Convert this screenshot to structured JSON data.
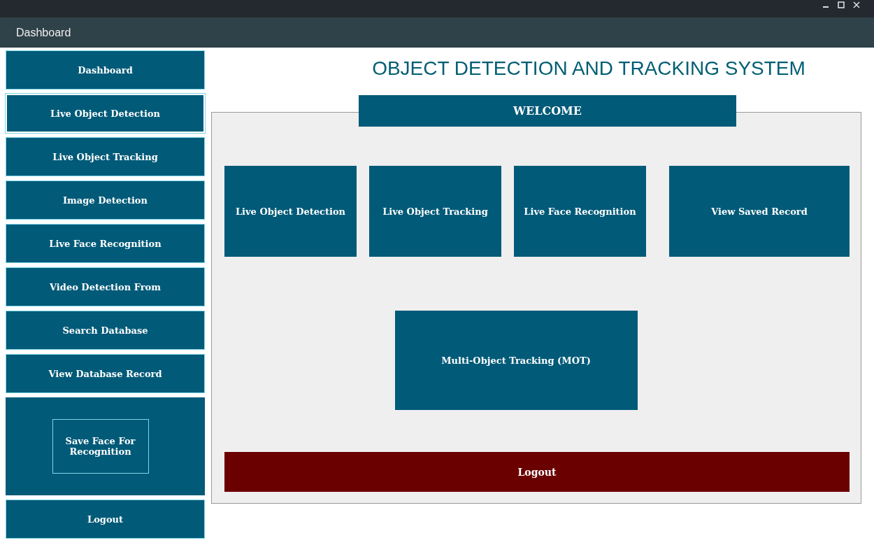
{
  "window": {
    "title": "Dashboard"
  },
  "sidebar": {
    "items": [
      {
        "kind": "button",
        "label": "Dashboard",
        "selected": false
      },
      {
        "kind": "button",
        "label": "Live Object Detection",
        "selected": true
      },
      {
        "kind": "button",
        "label": "Live Object Tracking",
        "selected": false
      },
      {
        "kind": "button",
        "label": "Image Detection",
        "selected": false
      },
      {
        "kind": "button",
        "label": "Live Face Recognition",
        "selected": false
      },
      {
        "kind": "button",
        "label": "Video Detection From",
        "selected": false
      },
      {
        "kind": "button",
        "label": "Search Database",
        "selected": false
      },
      {
        "kind": "button",
        "label": "View Database  Record",
        "selected": false
      },
      {
        "kind": "panel",
        "label": "Save Face For Recognition",
        "selected": false
      },
      {
        "kind": "button",
        "label": "Logout",
        "selected": false
      }
    ]
  },
  "main": {
    "heading": "OBJECT DETECTION AND TRACKING SYSTEM",
    "banner": "WELCOME",
    "tiles": [
      {
        "label": "Live Object Detection"
      },
      {
        "label": "Live Object Tracking"
      },
      {
        "label": "Live Face Recognition"
      },
      {
        "label": "View Saved Record"
      }
    ],
    "center_tile": {
      "label": "Multi-Object Tracking (MOT)"
    },
    "logout": {
      "label": "Logout"
    }
  }
}
